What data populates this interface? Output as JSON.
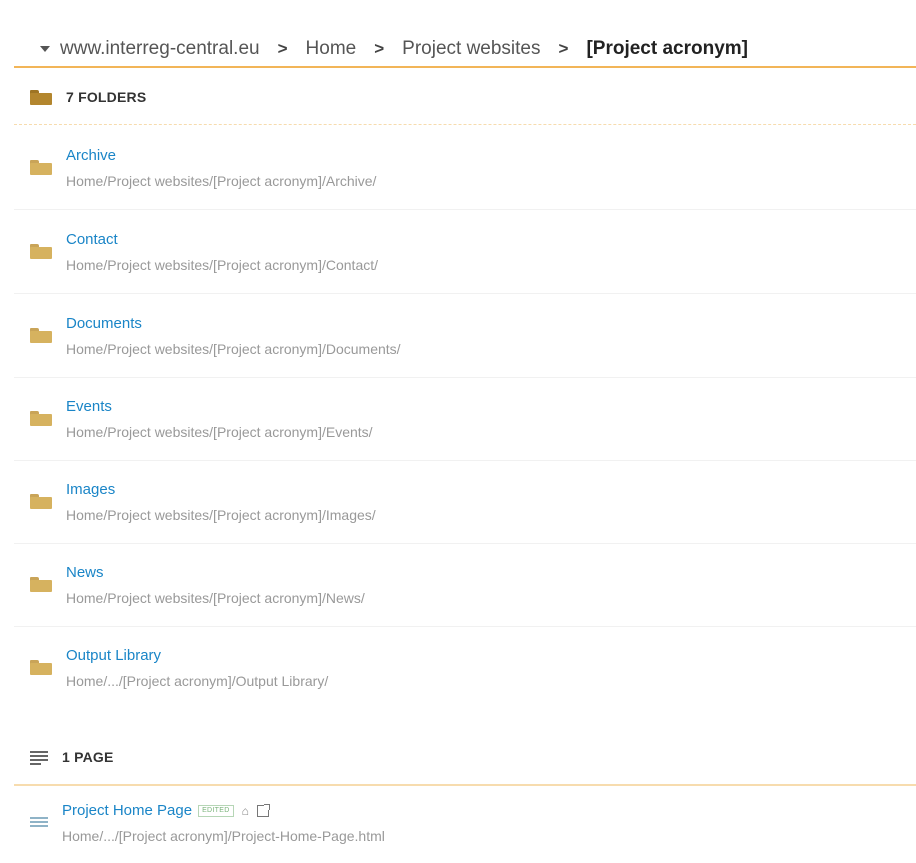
{
  "breadcrumb": {
    "items": [
      "www.interreg-central.eu",
      "Home",
      "Project websites"
    ],
    "separator": ">",
    "current": "[Project acronym]"
  },
  "folders": {
    "header": "7 FOLDERS",
    "items": [
      {
        "name": "Archive",
        "path": "Home/Project websites/[Project acronym]/Archive/"
      },
      {
        "name": "Contact",
        "path": "Home/Project websites/[Project acronym]/Contact/"
      },
      {
        "name": "Documents",
        "path": "Home/Project websites/[Project acronym]/Documents/"
      },
      {
        "name": "Events",
        "path": "Home/Project websites/[Project acronym]/Events/"
      },
      {
        "name": "Images",
        "path": "Home/Project websites/[Project acronym]/Images/"
      },
      {
        "name": "News",
        "path": "Home/Project websites/[Project acronym]/News/"
      },
      {
        "name": "Output Library",
        "path": "Home/.../[Project acronym]/Output Library/"
      }
    ]
  },
  "pages": {
    "header": "1 PAGE",
    "items": [
      {
        "name": "Project Home Page",
        "badge": "EDITED",
        "path": "Home/.../[Project acronym]/Project-Home-Page.html"
      }
    ]
  },
  "colors": {
    "accent": "#f2b558",
    "link": "#1a85c7",
    "folder": "#d6b25f",
    "badge": "#7ab37a"
  },
  "icons": [
    "chevron-down-icon",
    "folder-icon",
    "page-lines-icon",
    "home-icon",
    "external-link-icon"
  ]
}
